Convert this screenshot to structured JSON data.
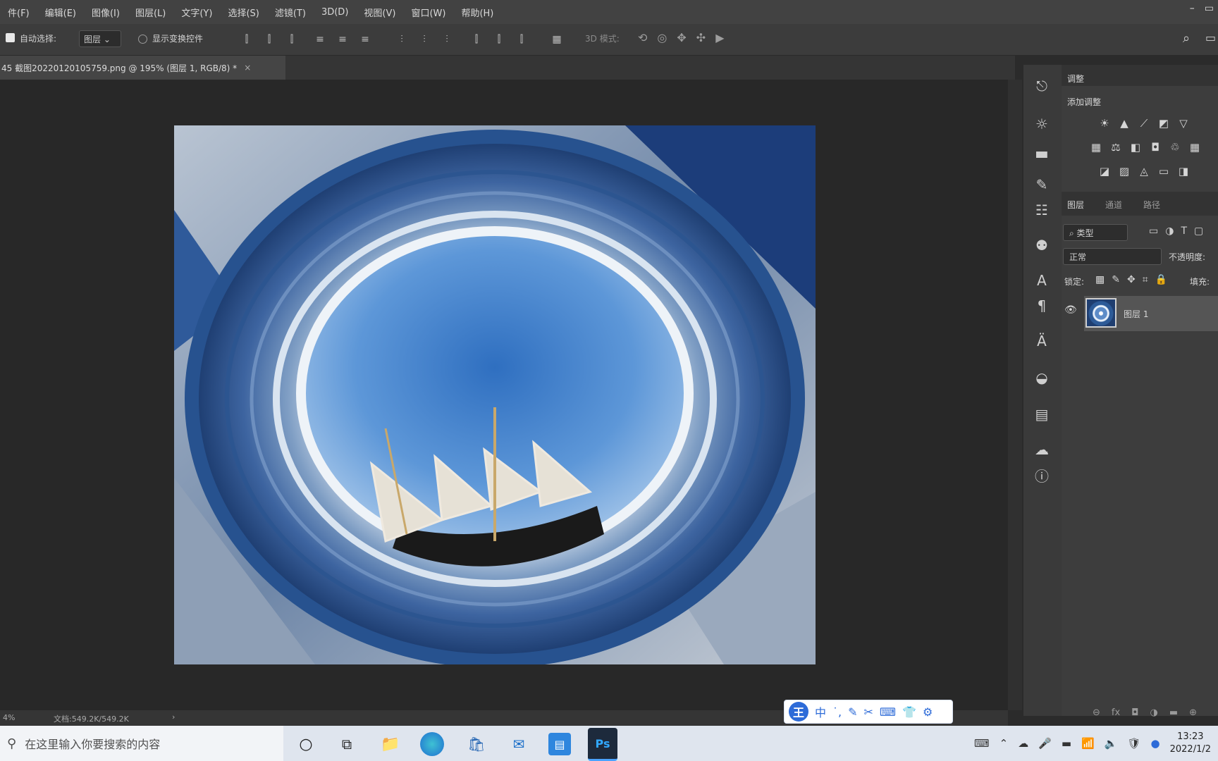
{
  "menu": [
    "件(F)",
    "编辑(E)",
    "图像(I)",
    "图层(L)",
    "文字(Y)",
    "选择(S)",
    "滤镜(T)",
    "3D(D)",
    "视图(V)",
    "窗口(W)",
    "帮助(H)"
  ],
  "options": {
    "auto_select_label": "自动选择:",
    "auto_select_value": "图层",
    "show_transform_label": "显示变换控件",
    "mode_3d_label": "3D 模式:"
  },
  "document_tab": {
    "title": "45 截图20220120105759.png @ 195% (图层 1, RGB/8) *",
    "close": "×"
  },
  "status": {
    "zoom": "4%",
    "doc_size": "文档:549.2K/549.2K",
    "arrow": "›"
  },
  "panels": {
    "adjust_tab": "调整",
    "add_adjust_label": "添加调整",
    "layer_tabs": [
      "图层",
      "通道",
      "路径"
    ],
    "filter_kind": "类型",
    "blend_mode": "正常",
    "opacity_label": "不透明度:",
    "lock_label": "锁定:",
    "fill_label": "填充:",
    "layer_name": "图层 1"
  },
  "ime": {
    "logo": "王",
    "lang": "中"
  },
  "taskbar": {
    "search_placeholder": "在这里输入你要搜索的内容",
    "ps_label": "Ps",
    "time": "13:23",
    "date": "2022/1/2"
  }
}
